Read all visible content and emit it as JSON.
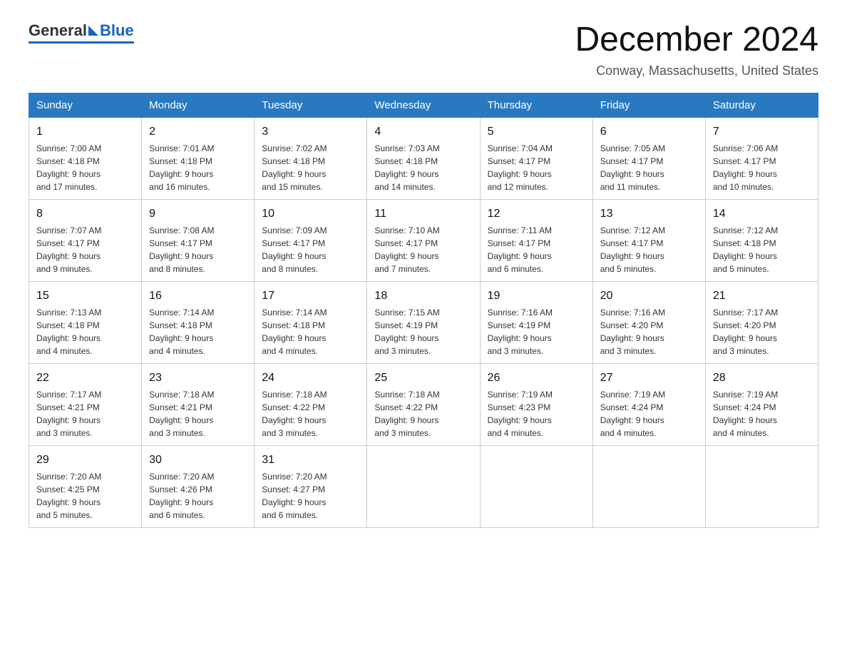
{
  "header": {
    "title": "December 2024",
    "subtitle": "Conway, Massachusetts, United States"
  },
  "logo": {
    "part1": "General",
    "part2": "Blue"
  },
  "days": [
    "Sunday",
    "Monday",
    "Tuesday",
    "Wednesday",
    "Thursday",
    "Friday",
    "Saturday"
  ],
  "weeks": [
    [
      {
        "day": "1",
        "sunrise": "7:00 AM",
        "sunset": "4:18 PM",
        "daylight": "9 hours and 17 minutes."
      },
      {
        "day": "2",
        "sunrise": "7:01 AM",
        "sunset": "4:18 PM",
        "daylight": "9 hours and 16 minutes."
      },
      {
        "day": "3",
        "sunrise": "7:02 AM",
        "sunset": "4:18 PM",
        "daylight": "9 hours and 15 minutes."
      },
      {
        "day": "4",
        "sunrise": "7:03 AM",
        "sunset": "4:18 PM",
        "daylight": "9 hours and 14 minutes."
      },
      {
        "day": "5",
        "sunrise": "7:04 AM",
        "sunset": "4:17 PM",
        "daylight": "9 hours and 12 minutes."
      },
      {
        "day": "6",
        "sunrise": "7:05 AM",
        "sunset": "4:17 PM",
        "daylight": "9 hours and 11 minutes."
      },
      {
        "day": "7",
        "sunrise": "7:06 AM",
        "sunset": "4:17 PM",
        "daylight": "9 hours and 10 minutes."
      }
    ],
    [
      {
        "day": "8",
        "sunrise": "7:07 AM",
        "sunset": "4:17 PM",
        "daylight": "9 hours and 9 minutes."
      },
      {
        "day": "9",
        "sunrise": "7:08 AM",
        "sunset": "4:17 PM",
        "daylight": "9 hours and 8 minutes."
      },
      {
        "day": "10",
        "sunrise": "7:09 AM",
        "sunset": "4:17 PM",
        "daylight": "9 hours and 8 minutes."
      },
      {
        "day": "11",
        "sunrise": "7:10 AM",
        "sunset": "4:17 PM",
        "daylight": "9 hours and 7 minutes."
      },
      {
        "day": "12",
        "sunrise": "7:11 AM",
        "sunset": "4:17 PM",
        "daylight": "9 hours and 6 minutes."
      },
      {
        "day": "13",
        "sunrise": "7:12 AM",
        "sunset": "4:17 PM",
        "daylight": "9 hours and 5 minutes."
      },
      {
        "day": "14",
        "sunrise": "7:12 AM",
        "sunset": "4:18 PM",
        "daylight": "9 hours and 5 minutes."
      }
    ],
    [
      {
        "day": "15",
        "sunrise": "7:13 AM",
        "sunset": "4:18 PM",
        "daylight": "9 hours and 4 minutes."
      },
      {
        "day": "16",
        "sunrise": "7:14 AM",
        "sunset": "4:18 PM",
        "daylight": "9 hours and 4 minutes."
      },
      {
        "day": "17",
        "sunrise": "7:14 AM",
        "sunset": "4:18 PM",
        "daylight": "9 hours and 4 minutes."
      },
      {
        "day": "18",
        "sunrise": "7:15 AM",
        "sunset": "4:19 PM",
        "daylight": "9 hours and 3 minutes."
      },
      {
        "day": "19",
        "sunrise": "7:16 AM",
        "sunset": "4:19 PM",
        "daylight": "9 hours and 3 minutes."
      },
      {
        "day": "20",
        "sunrise": "7:16 AM",
        "sunset": "4:20 PM",
        "daylight": "9 hours and 3 minutes."
      },
      {
        "day": "21",
        "sunrise": "7:17 AM",
        "sunset": "4:20 PM",
        "daylight": "9 hours and 3 minutes."
      }
    ],
    [
      {
        "day": "22",
        "sunrise": "7:17 AM",
        "sunset": "4:21 PM",
        "daylight": "9 hours and 3 minutes."
      },
      {
        "day": "23",
        "sunrise": "7:18 AM",
        "sunset": "4:21 PM",
        "daylight": "9 hours and 3 minutes."
      },
      {
        "day": "24",
        "sunrise": "7:18 AM",
        "sunset": "4:22 PM",
        "daylight": "9 hours and 3 minutes."
      },
      {
        "day": "25",
        "sunrise": "7:18 AM",
        "sunset": "4:22 PM",
        "daylight": "9 hours and 3 minutes."
      },
      {
        "day": "26",
        "sunrise": "7:19 AM",
        "sunset": "4:23 PM",
        "daylight": "9 hours and 4 minutes."
      },
      {
        "day": "27",
        "sunrise": "7:19 AM",
        "sunset": "4:24 PM",
        "daylight": "9 hours and 4 minutes."
      },
      {
        "day": "28",
        "sunrise": "7:19 AM",
        "sunset": "4:24 PM",
        "daylight": "9 hours and 4 minutes."
      }
    ],
    [
      {
        "day": "29",
        "sunrise": "7:20 AM",
        "sunset": "4:25 PM",
        "daylight": "9 hours and 5 minutes."
      },
      {
        "day": "30",
        "sunrise": "7:20 AM",
        "sunset": "4:26 PM",
        "daylight": "9 hours and 6 minutes."
      },
      {
        "day": "31",
        "sunrise": "7:20 AM",
        "sunset": "4:27 PM",
        "daylight": "9 hours and 6 minutes."
      },
      null,
      null,
      null,
      null
    ]
  ],
  "labels": {
    "sunrise": "Sunrise:",
    "sunset": "Sunset:",
    "daylight": "Daylight:"
  }
}
